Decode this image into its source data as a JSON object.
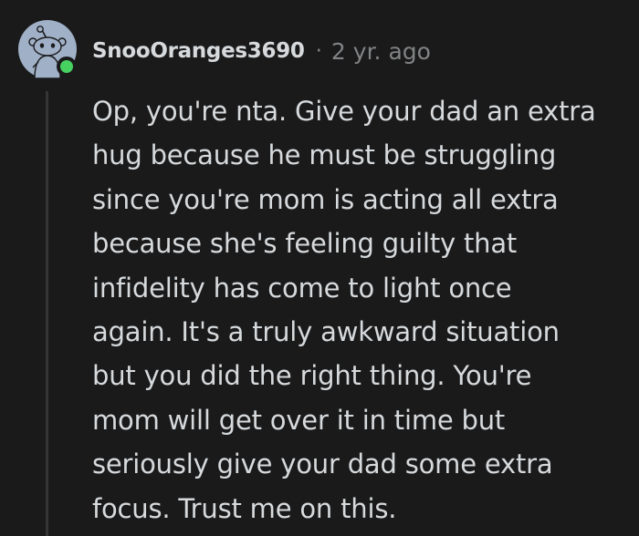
{
  "comment": {
    "author": "SnooOranges3690",
    "separator": "·",
    "timestamp": "2 yr. ago",
    "body_lines": [
      "Op, you're nta. Give your dad an extra",
      "hug because he must be struggling",
      "since you're mom is acting all extra",
      "because she's feeling guilty that",
      "infidelity has come to light once",
      "again. It's a truly awkward situation",
      "but you did the right thing. You're",
      "mom will get over it in time but",
      "seriously give your dad some extra",
      "focus. Trust me on this."
    ],
    "avatar_icon": "snoo-avatar-icon",
    "status_color": "#46d160"
  }
}
